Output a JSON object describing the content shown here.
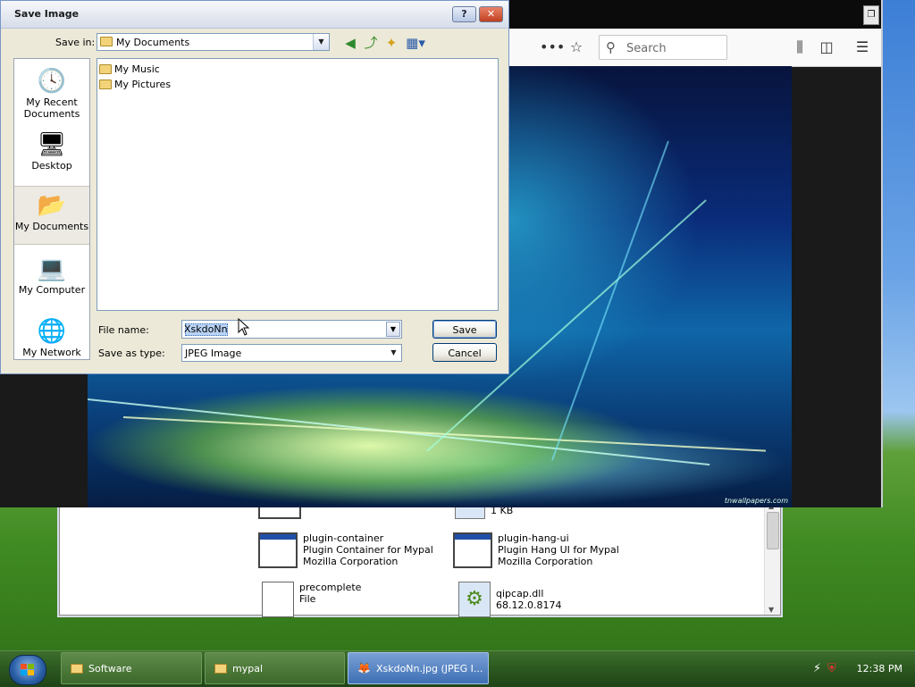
{
  "dialog": {
    "title": "Save Image",
    "save_in_label": "Save in:",
    "save_in_value": "My Documents",
    "places": [
      {
        "label": "My Recent\nDocuments",
        "icon": "recent-documents-icon"
      },
      {
        "label": "Desktop",
        "icon": "desktop-icon"
      },
      {
        "label": "My Documents",
        "icon": "my-documents-icon",
        "selected": true
      },
      {
        "label": "My Computer",
        "icon": "my-computer-icon"
      },
      {
        "label": "My Network",
        "icon": "my-network-icon"
      }
    ],
    "files": [
      "My Music",
      "My Pictures"
    ],
    "file_name_label": "File name:",
    "file_name_value": "XskdoNn",
    "save_as_type_label": "Save as type:",
    "save_as_type_value": "JPEG Image",
    "save_button": "Save",
    "cancel_button": "Cancel",
    "help_button": "?",
    "close_button": "✕"
  },
  "browser": {
    "search_placeholder": "Search",
    "wallpaper_credit": "tnwallpapers.com"
  },
  "explorer": {
    "items": [
      {
        "name": "plugin-container",
        "desc": "Plugin Container for Mypal",
        "company": "Mozilla Corporation"
      },
      {
        "name": "plugin-hang-ui",
        "desc": "Plugin Hang UI for Mypal",
        "company": "Mozilla Corporation"
      },
      {
        "name": "precomplete",
        "desc": "File",
        "company": ""
      },
      {
        "name": "qipcap.dll",
        "desc": "68.12.0.8174",
        "company": ""
      }
    ],
    "partial_size": "1 KB"
  },
  "taskbar": {
    "tasks": [
      {
        "label": "Software"
      },
      {
        "label": "mypal"
      },
      {
        "label": "XskdoNn.jpg (JPEG I..."
      }
    ],
    "clock": "12:38 PM"
  }
}
